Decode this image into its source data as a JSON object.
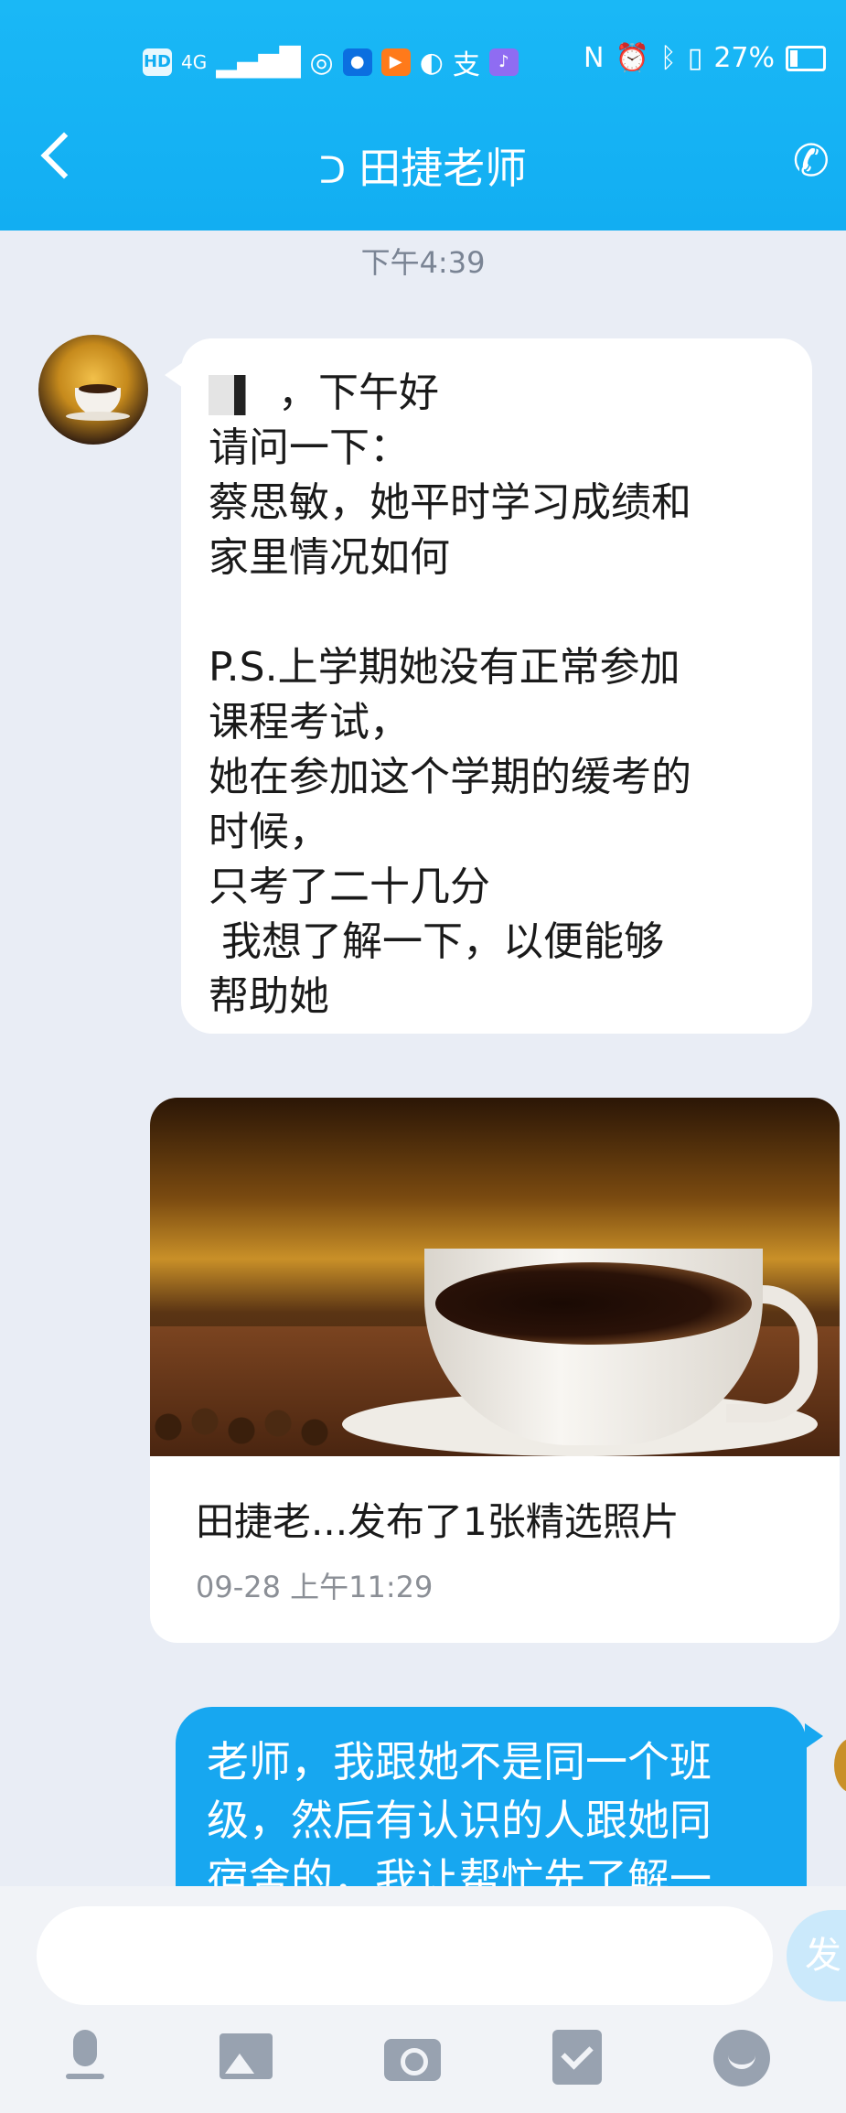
{
  "status_bar": {
    "network_left": "HD",
    "signal": "4G",
    "battery_text": "27%"
  },
  "header": {
    "title": "田捷老师",
    "ear_icon": "hearing-ear-icon",
    "back_icon": "chevron-left-icon",
    "call_icon": "phone-icon"
  },
  "chat": {
    "time_label": "下午4:39",
    "incoming_message": {
      "greeting_suffix": "，下午好",
      "body": "请问一下：\n蔡思敏，她平时学习成绩和\n家里情况如何\n\nP.S.上学期她没有正常参加\n课程考试，\n她在参加这个学期的缓考的\n时候，\n只考了二十几分\n 我想了解一下，以便能够\n帮助她"
    },
    "shared_card": {
      "title": "田捷老...发布了1张精选照片",
      "date": "09-28 上午11:29"
    },
    "outgoing_message": {
      "text": "老师，我跟她不是同一个班\n级，然后有认识的人跟她同\n宿舍的，我让帮忙先了解一"
    }
  },
  "composer": {
    "placeholder": "",
    "send_label": "发"
  },
  "toolbar": {
    "icons": [
      "microphone-icon",
      "image-icon",
      "camera-icon",
      "red-envelope-icon",
      "emoji-icon"
    ]
  },
  "colors": {
    "header": "#12aef2",
    "outgoing_bubble": "#17a7f0",
    "background": "#e9edf5"
  }
}
